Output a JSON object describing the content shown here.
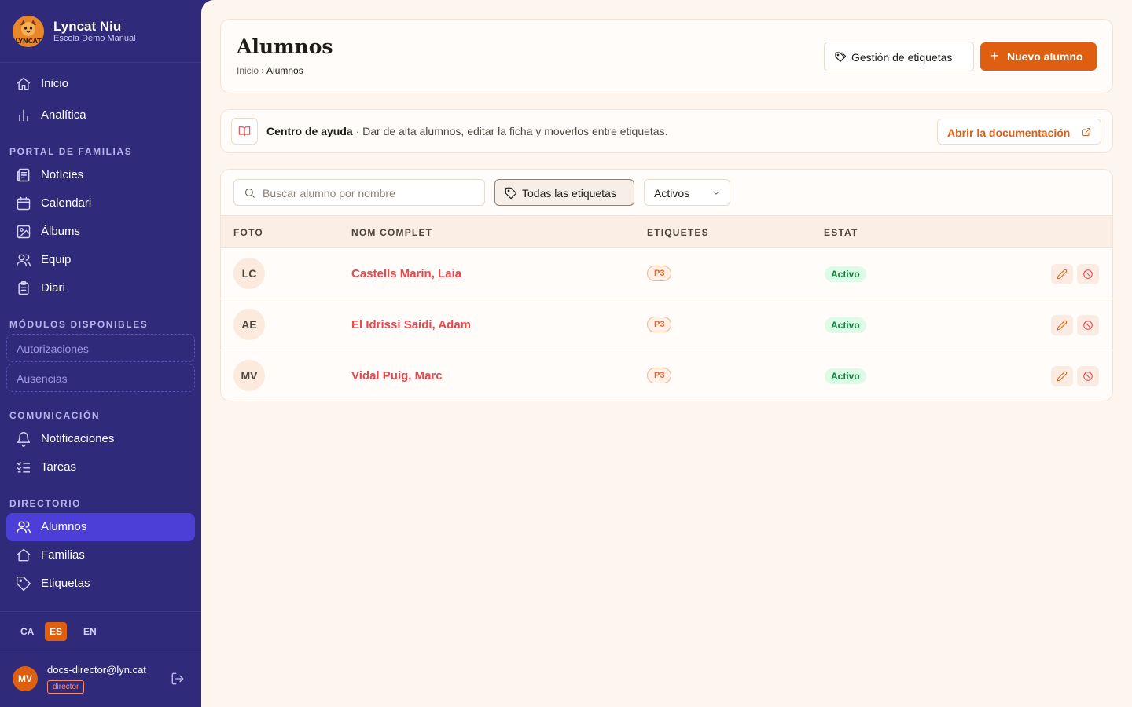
{
  "brand": {
    "name": "Lyncat Niu",
    "subtitle": "Escola Demo Manual",
    "logo_text": "LYNCAT"
  },
  "nav": {
    "top": [
      {
        "label": "Inicio",
        "icon": "home-icon"
      },
      {
        "label": "Analítica",
        "icon": "bar-chart-icon"
      }
    ],
    "sections": [
      {
        "title": "PORTAL DE FAMILIAS",
        "items": [
          {
            "label": "Notícies",
            "icon": "newspaper-icon"
          },
          {
            "label": "Calendari",
            "icon": "calendar-icon"
          },
          {
            "label": "Àlbums",
            "icon": "image-icon"
          },
          {
            "label": "Equip",
            "icon": "users-icon"
          },
          {
            "label": "Diari",
            "icon": "clipboard-icon"
          }
        ]
      },
      {
        "title": "MÓDULOS DISPONIBLES",
        "items": [
          {
            "label": "Autorizaciones"
          },
          {
            "label": "Ausencias"
          }
        ]
      },
      {
        "title": "COMUNICACIÓN",
        "items": [
          {
            "label": "Notificaciones",
            "icon": "bell-icon"
          },
          {
            "label": "Tareas",
            "icon": "list-checks-icon"
          }
        ]
      },
      {
        "title": "DIRECTORIO",
        "items": [
          {
            "label": "Alumnos",
            "icon": "users-icon",
            "active": true
          },
          {
            "label": "Familias",
            "icon": "home-icon"
          },
          {
            "label": "Etiquetas",
            "icon": "tag-icon"
          }
        ]
      }
    ]
  },
  "languages": [
    {
      "code": "CA",
      "active": false
    },
    {
      "code": "ES",
      "active": true
    },
    {
      "code": "EN",
      "active": false
    }
  ],
  "user": {
    "initials": "MV",
    "email": "docs-director@lyn.cat",
    "role": "director"
  },
  "page": {
    "title": "Alumnos",
    "breadcrumb": {
      "home": "Inicio",
      "separator": "›",
      "current": "Alumnos"
    },
    "tags_button": "Gestión de etiquetas",
    "new_button": "Nuevo alumno"
  },
  "help": {
    "title": "Centro de ayuda",
    "text": "· Dar de alta alumnos, editar la ficha y moverlos entre etiquetas.",
    "link": "Abrir la documentación"
  },
  "filters": {
    "search_placeholder": "Buscar alumno por nombre",
    "search_value": "",
    "tag_filter": "Todas las etiquetas",
    "status": "Activos"
  },
  "table": {
    "columns": [
      "FOTO",
      "NOM COMPLET",
      "ETIQUETES",
      "ESTAT"
    ],
    "rows": [
      {
        "initials": "LC",
        "name": "Castells Marín, Laia",
        "tag": "P3",
        "status": "Activo"
      },
      {
        "initials": "AE",
        "name": "El Idrissi Saidi, Adam",
        "tag": "P3",
        "status": "Activo"
      },
      {
        "initials": "MV",
        "name": "Vidal Puig, Marc",
        "tag": "P3",
        "status": "Activo"
      }
    ]
  },
  "colors": {
    "sidebar_bg": "#2f2a7a",
    "active_nav": "#4b3fd8",
    "accent": "#dd5f0f",
    "link_red": "#e5484d",
    "status_green": "#15803d",
    "main_bg": "#fdf5ee"
  }
}
